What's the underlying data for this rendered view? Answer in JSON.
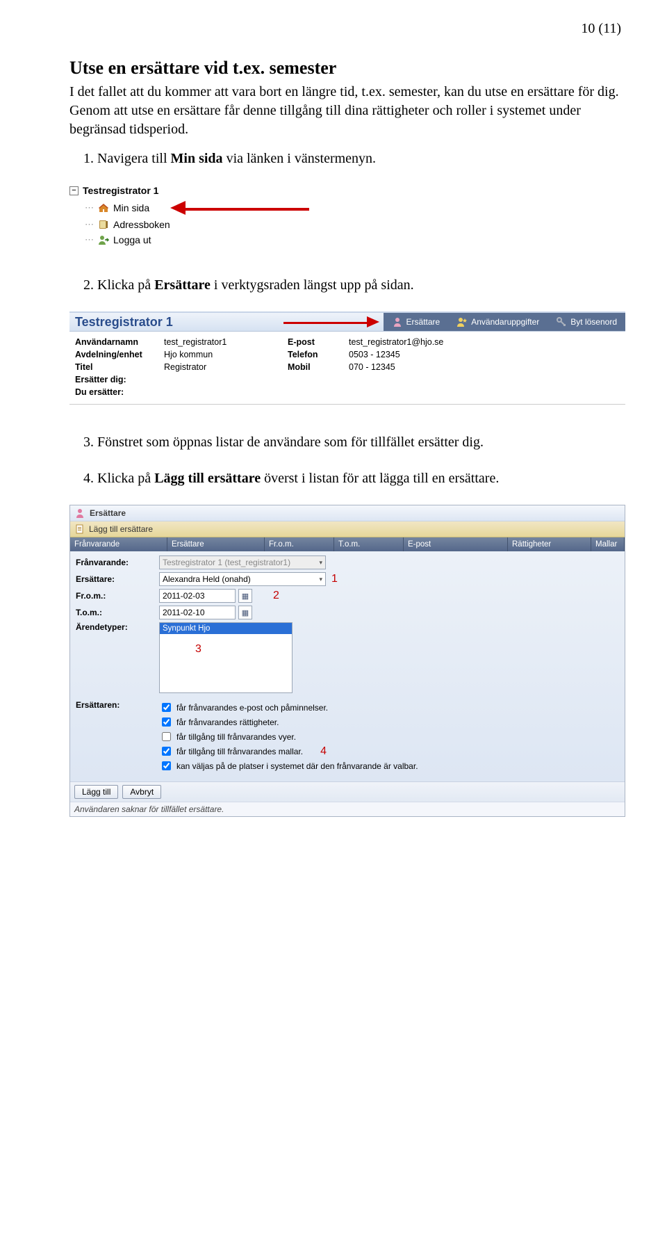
{
  "page_number": "10 (11)",
  "heading": "Utse en ersättare vid t.ex. semester",
  "intro": "I det fallet att du kommer att vara bort en längre tid, t.ex. semester, kan du utse en ersättare för dig. Genom att utse en ersättare får denne tillgång till dina rättigheter och roller i systemet under begränsad tidsperiod.",
  "steps": {
    "s1_pre": "Navigera till ",
    "s1_bold": "Min sida",
    "s1_post": " via länken i vänstermenyn.",
    "s2_pre": "Klicka på ",
    "s2_bold": "Ersättare",
    "s2_post": " i verktygsraden längst upp på sidan.",
    "s3_full": "Fönstret som öppnas listar de användare som för tillfället ersätter dig.",
    "s4_pre": "Klicka på ",
    "s4_bold": "Lägg till ersättare",
    "s4_post": " överst i listan för att lägga till en ersättare."
  },
  "tree": {
    "root": "Testregistrator 1",
    "items": [
      "Min sida",
      "Adressboken",
      "Logga ut"
    ]
  },
  "detail": {
    "title": "Testregistrator 1",
    "actions": [
      "Ersättare",
      "Användaruppgifter",
      "Byt lösenord"
    ],
    "labels": {
      "username": "Användarnamn",
      "department": "Avdelning/enhet",
      "title": "Titel",
      "replaces_you": "Ersätter dig:",
      "you_replace": "Du ersätter:",
      "email": "E-post",
      "phone": "Telefon",
      "mobile": "Mobil"
    },
    "values": {
      "username": "test_registrator1",
      "department": "Hjo kommun",
      "title": "Registrator",
      "email": "test_registrator1@hjo.se",
      "phone": "0503 - 12345",
      "mobile": "070 - 12345"
    }
  },
  "dlg": {
    "title": "Ersättare",
    "add_button": "Lägg till ersättare",
    "headers": [
      "Frånvarande",
      "Ersättare",
      "Fr.o.m.",
      "T.o.m.",
      "E-post",
      "Rättigheter",
      "Mallar"
    ],
    "form": {
      "absent_label": "Frånvarande:",
      "absent_value": "Testregistrator 1 (test_registrator1)",
      "replacement_label": "Ersättare:",
      "replacement_value": "Alexandra Held (onahd)",
      "from_label": "Fr.o.m.:",
      "from_value": "2011-02-03",
      "to_label": "T.o.m.:",
      "to_value": "2011-02-10",
      "casetypes_label": "Ärendetyper:",
      "casetype_selected": "Synpunkt Hjo",
      "replacer_label": "Ersättaren:"
    },
    "perms": [
      {
        "text": "får frånvarandes e-post och påminnelser.",
        "checked": true
      },
      {
        "text": "får frånvarandes rättigheter.",
        "checked": true
      },
      {
        "text": "får tillgång till frånvarandes vyer.",
        "checked": false
      },
      {
        "text": "får tillgång till frånvarandes mallar.",
        "checked": true
      },
      {
        "text": "kan väljas på de platser i systemet där den frånvarande är valbar.",
        "checked": true
      }
    ],
    "btn_add": "Lägg till",
    "btn_cancel": "Avbryt",
    "status": "Användaren saknar för tillfället ersättare.",
    "callouts": {
      "c1": "1",
      "c2": "2",
      "c3": "3",
      "c4": "4"
    }
  }
}
